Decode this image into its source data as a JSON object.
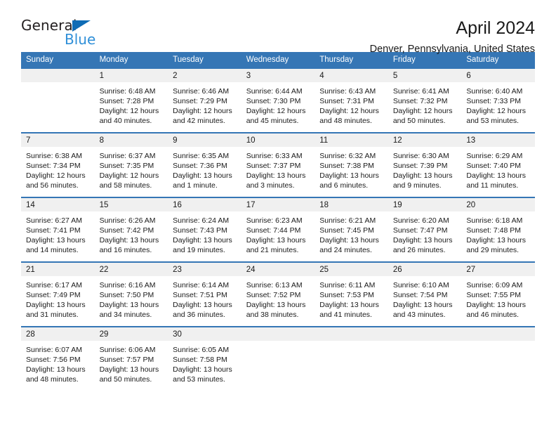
{
  "brand": {
    "name_part1": "General",
    "name_part2": "Blue",
    "triangle_color": "#0f6cb5",
    "blue_color": "#2f8fd8"
  },
  "header": {
    "title": "April 2024",
    "location": "Denver, Pennsylvania, United States"
  },
  "theme": {
    "header_band_color": "#3576b5",
    "daynum_band_color": "#f0f0f0",
    "text_color": "#1a1a1a"
  },
  "labels": {
    "sunrise_prefix": "Sunrise:",
    "sunset_prefix": "Sunset:",
    "daylight_prefix": "Daylight:"
  },
  "weekday_headers": [
    "Sunday",
    "Monday",
    "Tuesday",
    "Wednesday",
    "Thursday",
    "Friday",
    "Saturday"
  ],
  "weeks": [
    [
      {
        "day": "",
        "empty": true,
        "sunrise": "",
        "sunset": "",
        "daylight_line1": "",
        "daylight_line2": ""
      },
      {
        "day": "1",
        "empty": false,
        "sunrise": "Sunrise: 6:48 AM",
        "sunset": "Sunset: 7:28 PM",
        "daylight_line1": "Daylight: 12 hours",
        "daylight_line2": "and 40 minutes."
      },
      {
        "day": "2",
        "empty": false,
        "sunrise": "Sunrise: 6:46 AM",
        "sunset": "Sunset: 7:29 PM",
        "daylight_line1": "Daylight: 12 hours",
        "daylight_line2": "and 42 minutes."
      },
      {
        "day": "3",
        "empty": false,
        "sunrise": "Sunrise: 6:44 AM",
        "sunset": "Sunset: 7:30 PM",
        "daylight_line1": "Daylight: 12 hours",
        "daylight_line2": "and 45 minutes."
      },
      {
        "day": "4",
        "empty": false,
        "sunrise": "Sunrise: 6:43 AM",
        "sunset": "Sunset: 7:31 PM",
        "daylight_line1": "Daylight: 12 hours",
        "daylight_line2": "and 48 minutes."
      },
      {
        "day": "5",
        "empty": false,
        "sunrise": "Sunrise: 6:41 AM",
        "sunset": "Sunset: 7:32 PM",
        "daylight_line1": "Daylight: 12 hours",
        "daylight_line2": "and 50 minutes."
      },
      {
        "day": "6",
        "empty": false,
        "sunrise": "Sunrise: 6:40 AM",
        "sunset": "Sunset: 7:33 PM",
        "daylight_line1": "Daylight: 12 hours",
        "daylight_line2": "and 53 minutes."
      }
    ],
    [
      {
        "day": "7",
        "empty": false,
        "sunrise": "Sunrise: 6:38 AM",
        "sunset": "Sunset: 7:34 PM",
        "daylight_line1": "Daylight: 12 hours",
        "daylight_line2": "and 56 minutes."
      },
      {
        "day": "8",
        "empty": false,
        "sunrise": "Sunrise: 6:37 AM",
        "sunset": "Sunset: 7:35 PM",
        "daylight_line1": "Daylight: 12 hours",
        "daylight_line2": "and 58 minutes."
      },
      {
        "day": "9",
        "empty": false,
        "sunrise": "Sunrise: 6:35 AM",
        "sunset": "Sunset: 7:36 PM",
        "daylight_line1": "Daylight: 13 hours",
        "daylight_line2": "and 1 minute."
      },
      {
        "day": "10",
        "empty": false,
        "sunrise": "Sunrise: 6:33 AM",
        "sunset": "Sunset: 7:37 PM",
        "daylight_line1": "Daylight: 13 hours",
        "daylight_line2": "and 3 minutes."
      },
      {
        "day": "11",
        "empty": false,
        "sunrise": "Sunrise: 6:32 AM",
        "sunset": "Sunset: 7:38 PM",
        "daylight_line1": "Daylight: 13 hours",
        "daylight_line2": "and 6 minutes."
      },
      {
        "day": "12",
        "empty": false,
        "sunrise": "Sunrise: 6:30 AM",
        "sunset": "Sunset: 7:39 PM",
        "daylight_line1": "Daylight: 13 hours",
        "daylight_line2": "and 9 minutes."
      },
      {
        "day": "13",
        "empty": false,
        "sunrise": "Sunrise: 6:29 AM",
        "sunset": "Sunset: 7:40 PM",
        "daylight_line1": "Daylight: 13 hours",
        "daylight_line2": "and 11 minutes."
      }
    ],
    [
      {
        "day": "14",
        "empty": false,
        "sunrise": "Sunrise: 6:27 AM",
        "sunset": "Sunset: 7:41 PM",
        "daylight_line1": "Daylight: 13 hours",
        "daylight_line2": "and 14 minutes."
      },
      {
        "day": "15",
        "empty": false,
        "sunrise": "Sunrise: 6:26 AM",
        "sunset": "Sunset: 7:42 PM",
        "daylight_line1": "Daylight: 13 hours",
        "daylight_line2": "and 16 minutes."
      },
      {
        "day": "16",
        "empty": false,
        "sunrise": "Sunrise: 6:24 AM",
        "sunset": "Sunset: 7:43 PM",
        "daylight_line1": "Daylight: 13 hours",
        "daylight_line2": "and 19 minutes."
      },
      {
        "day": "17",
        "empty": false,
        "sunrise": "Sunrise: 6:23 AM",
        "sunset": "Sunset: 7:44 PM",
        "daylight_line1": "Daylight: 13 hours",
        "daylight_line2": "and 21 minutes."
      },
      {
        "day": "18",
        "empty": false,
        "sunrise": "Sunrise: 6:21 AM",
        "sunset": "Sunset: 7:45 PM",
        "daylight_line1": "Daylight: 13 hours",
        "daylight_line2": "and 24 minutes."
      },
      {
        "day": "19",
        "empty": false,
        "sunrise": "Sunrise: 6:20 AM",
        "sunset": "Sunset: 7:47 PM",
        "daylight_line1": "Daylight: 13 hours",
        "daylight_line2": "and 26 minutes."
      },
      {
        "day": "20",
        "empty": false,
        "sunrise": "Sunrise: 6:18 AM",
        "sunset": "Sunset: 7:48 PM",
        "daylight_line1": "Daylight: 13 hours",
        "daylight_line2": "and 29 minutes."
      }
    ],
    [
      {
        "day": "21",
        "empty": false,
        "sunrise": "Sunrise: 6:17 AM",
        "sunset": "Sunset: 7:49 PM",
        "daylight_line1": "Daylight: 13 hours",
        "daylight_line2": "and 31 minutes."
      },
      {
        "day": "22",
        "empty": false,
        "sunrise": "Sunrise: 6:16 AM",
        "sunset": "Sunset: 7:50 PM",
        "daylight_line1": "Daylight: 13 hours",
        "daylight_line2": "and 34 minutes."
      },
      {
        "day": "23",
        "empty": false,
        "sunrise": "Sunrise: 6:14 AM",
        "sunset": "Sunset: 7:51 PM",
        "daylight_line1": "Daylight: 13 hours",
        "daylight_line2": "and 36 minutes."
      },
      {
        "day": "24",
        "empty": false,
        "sunrise": "Sunrise: 6:13 AM",
        "sunset": "Sunset: 7:52 PM",
        "daylight_line1": "Daylight: 13 hours",
        "daylight_line2": "and 38 minutes."
      },
      {
        "day": "25",
        "empty": false,
        "sunrise": "Sunrise: 6:11 AM",
        "sunset": "Sunset: 7:53 PM",
        "daylight_line1": "Daylight: 13 hours",
        "daylight_line2": "and 41 minutes."
      },
      {
        "day": "26",
        "empty": false,
        "sunrise": "Sunrise: 6:10 AM",
        "sunset": "Sunset: 7:54 PM",
        "daylight_line1": "Daylight: 13 hours",
        "daylight_line2": "and 43 minutes."
      },
      {
        "day": "27",
        "empty": false,
        "sunrise": "Sunrise: 6:09 AM",
        "sunset": "Sunset: 7:55 PM",
        "daylight_line1": "Daylight: 13 hours",
        "daylight_line2": "and 46 minutes."
      }
    ],
    [
      {
        "day": "28",
        "empty": false,
        "sunrise": "Sunrise: 6:07 AM",
        "sunset": "Sunset: 7:56 PM",
        "daylight_line1": "Daylight: 13 hours",
        "daylight_line2": "and 48 minutes."
      },
      {
        "day": "29",
        "empty": false,
        "sunrise": "Sunrise: 6:06 AM",
        "sunset": "Sunset: 7:57 PM",
        "daylight_line1": "Daylight: 13 hours",
        "daylight_line2": "and 50 minutes."
      },
      {
        "day": "30",
        "empty": false,
        "sunrise": "Sunrise: 6:05 AM",
        "sunset": "Sunset: 7:58 PM",
        "daylight_line1": "Daylight: 13 hours",
        "daylight_line2": "and 53 minutes."
      },
      {
        "day": "",
        "empty": true,
        "sunrise": "",
        "sunset": "",
        "daylight_line1": "",
        "daylight_line2": ""
      },
      {
        "day": "",
        "empty": true,
        "sunrise": "",
        "sunset": "",
        "daylight_line1": "",
        "daylight_line2": ""
      },
      {
        "day": "",
        "empty": true,
        "sunrise": "",
        "sunset": "",
        "daylight_line1": "",
        "daylight_line2": ""
      },
      {
        "day": "",
        "empty": true,
        "sunrise": "",
        "sunset": "",
        "daylight_line1": "",
        "daylight_line2": ""
      }
    ]
  ]
}
